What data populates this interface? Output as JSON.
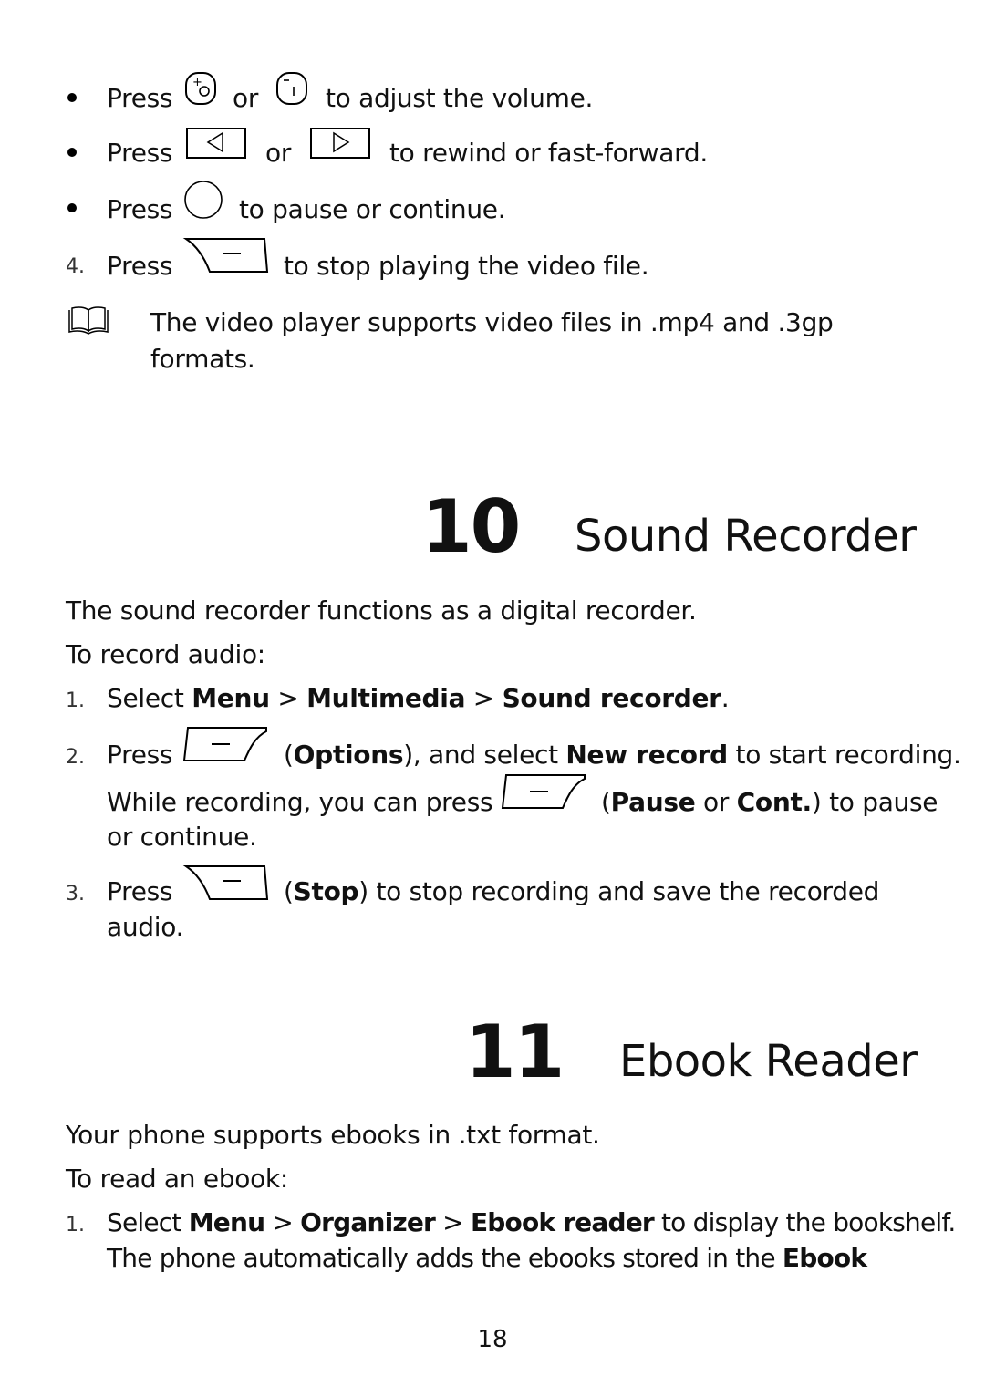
{
  "video_controls": {
    "volume": {
      "press": "Press",
      "or": "or",
      "rest": "to adjust the volume."
    },
    "seek": {
      "press": "Press",
      "or": "or",
      "rest": "to rewind or fast-forward."
    },
    "pause": {
      "press": "Press",
      "rest": "to pause or continue."
    },
    "stop": {
      "num": "4.",
      "press": "Press",
      "rest": "to stop playing the video file."
    },
    "note": {
      "line1": "The video player supports video files in .mp4 and .3gp",
      "line2": "formats."
    }
  },
  "chapter10": {
    "number": "10",
    "title": "Sound Recorder",
    "intro": "The sound recorder functions as a digital recorder.",
    "lead": "To record audio:",
    "step1": {
      "num": "1.",
      "pre": "Select ",
      "menu": "Menu",
      "sep1": " > ",
      "multimedia": "Multimedia",
      "sep2": " > ",
      "target": "Sound recorder",
      "end": "."
    },
    "step2": {
      "num": "2.",
      "press": "Press",
      "open": "(",
      "options": "Options",
      "mid": "), and select ",
      "new_record": "New record",
      "end": " to start recording.",
      "line2_pre": "While recording, you can press",
      "open2": "(",
      "pause": "Pause",
      "or": " or ",
      "cont": "Cont.",
      "line2_end": ") to pause",
      "line3": "or continue."
    },
    "step3": {
      "num": "3.",
      "press": "Press",
      "open": "(",
      "stop": "Stop",
      "rest": ") to stop recording and save the recorded",
      "line2": "audio."
    }
  },
  "chapter11": {
    "number": "11",
    "title": "Ebook Reader",
    "intro": "Your phone supports ebooks in .txt format.",
    "lead": "To read an ebook:",
    "step1": {
      "num": "1.",
      "pre": "Select ",
      "menu": "Menu",
      "sep1": " > ",
      "organizer": "Organizer",
      "sep2": " > ",
      "ebook_reader": "Ebook reader",
      "rest": " to display the bookshelf.",
      "line2_pre": "The phone automatically adds the ebooks stored in the ",
      "ebook": "Ebook"
    }
  },
  "page_number": "18"
}
